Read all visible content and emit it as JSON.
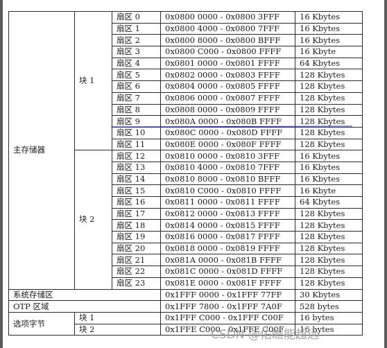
{
  "heading_cut": "",
  "main_memory": {
    "label": "主存储器",
    "block1_label": "块 1",
    "block2_label": "块 2",
    "rows": [
      {
        "sector": "扇区 0",
        "range": "0x0800 0000 - 0x0800 3FFF",
        "size": "16 Kbytes"
      },
      {
        "sector": "扇区 1",
        "range": "0x0800 4000 - 0x0800 7FFF",
        "size": "16 Kbytes"
      },
      {
        "sector": "扇区 2",
        "range": "0x0800 8000 - 0x0800 BFFF",
        "size": "16 Kbytes"
      },
      {
        "sector": "扇区 3",
        "range": "0x0800 C000 - 0x0800 FFFF",
        "size": "16 Kbyte"
      },
      {
        "sector": "扇区 4",
        "range": "0x0801 0000 - 0x0801 FFFF",
        "size": "64 Kbytes"
      },
      {
        "sector": "扇区 5",
        "range": "0x0802 0000 - 0x0803 FFFF",
        "size": "128 Kbytes"
      },
      {
        "sector": "扇区 6",
        "range": "0x0804 0000 - 0x0805 FFFF",
        "size": "128 Kbytes"
      },
      {
        "sector": "扇区 7",
        "range": "0x0806 0000 - 0x0807 FFFF",
        "size": "128 Kbytes"
      },
      {
        "sector": "扇区 8",
        "range": "0x0808 0000 - 0x0809 FFFF",
        "size": "128 Kbytes"
      },
      {
        "sector": "扇区 9",
        "range": "0x080A 0000 - 0x080B FFFF",
        "size": "128 Kbytes"
      },
      {
        "sector": "扇区 10",
        "range": "0x080C 0000 - 0x080D FFFF",
        "size": "128 Kbytes"
      },
      {
        "sector": "扇区 11",
        "range": "0x080E 0000 - 0x080F FFFF",
        "size": "128 Kbytes"
      },
      {
        "sector": "扇区 12",
        "range": "0x0810 0000 - 0x0810 3FFF",
        "size": "16 Kbytes"
      },
      {
        "sector": "扇区 13",
        "range": "0x0810 4000 - 0x0810 7FFF",
        "size": "16 Kbytes"
      },
      {
        "sector": "扇区 14",
        "range": "0x0810 8000 - 0x0810 BFFF",
        "size": "16 Kbytes"
      },
      {
        "sector": "扇区 15",
        "range": "0x0810 C000 - 0x0810 FFFF",
        "size": "16 Kbyte"
      },
      {
        "sector": "扇区 16",
        "range": "0x0811 0000 - 0x0811 FFFF",
        "size": "64 Kbytes"
      },
      {
        "sector": "扇区 17",
        "range": "0x0812 0000 - 0x0813 FFFF",
        "size": "128 Kbytes"
      },
      {
        "sector": "扇区 18",
        "range": "0x0814 0000 - 0x0815 FFFF",
        "size": "128 Kbytes"
      },
      {
        "sector": "扇区 19",
        "range": "0x0816 0000 - 0x0817 FFFF",
        "size": "128 Kbytes"
      },
      {
        "sector": "扇区 20",
        "range": "0x0818 0000 - 0x0819 FFFF",
        "size": "128 Kbytes"
      },
      {
        "sector": "扇区 21",
        "range": "0x081A 0000 - 0x081B FFFF",
        "size": "128 Kbytes"
      },
      {
        "sector": "扇区 22",
        "range": "0x081C 0000 - 0x081D FFFF",
        "size": "128 Kbytes"
      },
      {
        "sector": "扇区 23",
        "range": "0x081E 0000 - 0x081F FFFF",
        "size": "128 Kbytes"
      }
    ]
  },
  "system_memory": {
    "label": "系统存储区",
    "range": "0x1FFF 0000 - 0x1FFF 77FF",
    "size": "30 Kbytes"
  },
  "otp_area": {
    "label": "OTP 区域",
    "range": "0x1FFF 7800 - 0x1FFF 7A0F",
    "size": "528 bytes"
  },
  "option_bytes": {
    "label": "选项字节",
    "rows": [
      {
        "block": "块 1",
        "range": "0x1FFF C000 - 0x1FFF C00F",
        "size": "16 bytes"
      },
      {
        "block": "块 2",
        "range": "0x1FFE C000 - 0x1FFE C00F",
        "size": "16 bytes"
      }
    ]
  },
  "watermark": "CSDN @佑瞻能超远"
}
